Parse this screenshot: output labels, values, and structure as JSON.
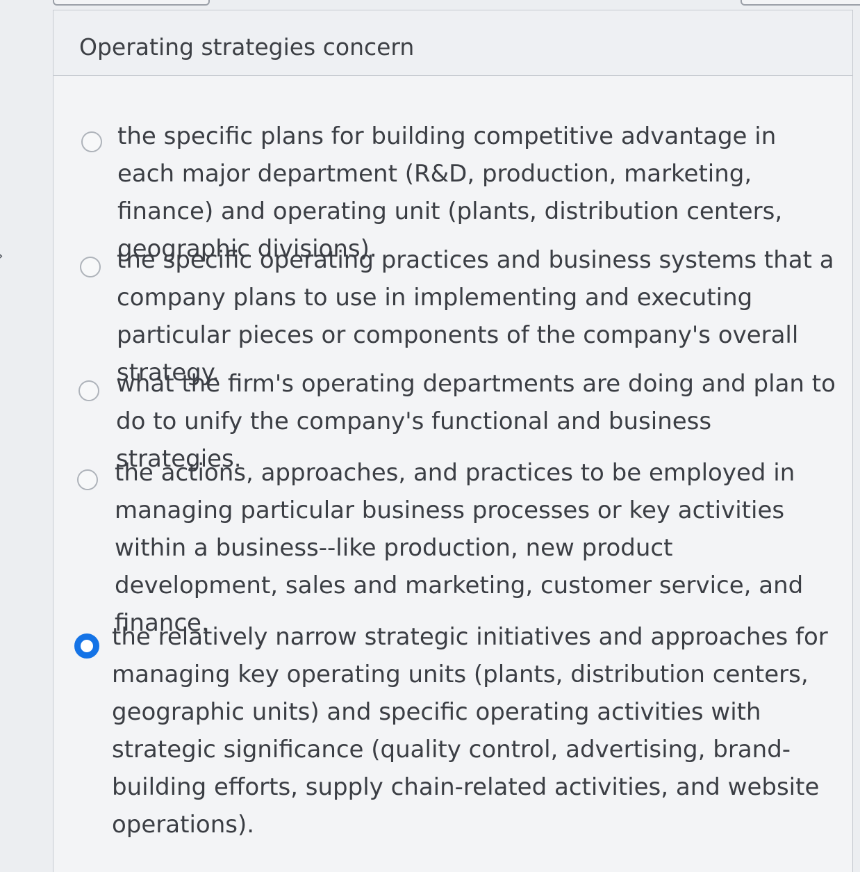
{
  "question": {
    "text": "Operating strategies concern"
  },
  "options": [
    {
      "label": "the specific plans for building competitive advantage in each major department (R&D, production, marketing, finance) and operating unit (plants, distribution centers, geographic divisions).",
      "selected": false
    },
    {
      "label": "the specific operating practices and business systems that a company plans to use in implementing and executing particular pieces or components of the company's overall strategy.",
      "selected": false
    },
    {
      "label": "what the firm's operating departments are doing and plan to do to unify the company's functional and business strategies.",
      "selected": false
    },
    {
      "label": "the actions, approaches, and practices to be employed in managing particular business processes or key activities within a business--like production, new product development, sales and marketing, customer service, and finance.",
      "selected": false
    },
    {
      "label": "the relatively narrow strategic initiatives and approaches for managing key operating units (plants, distribution centers, geographic units) and specific operating activities with strategic significance (quality control, advertising, brand-building efforts, supply chain-related activities, and website operations).",
      "selected": true
    }
  ],
  "colors": {
    "accent": "#1473e6",
    "text": "#3b3e44",
    "border": "#c6cad0"
  }
}
